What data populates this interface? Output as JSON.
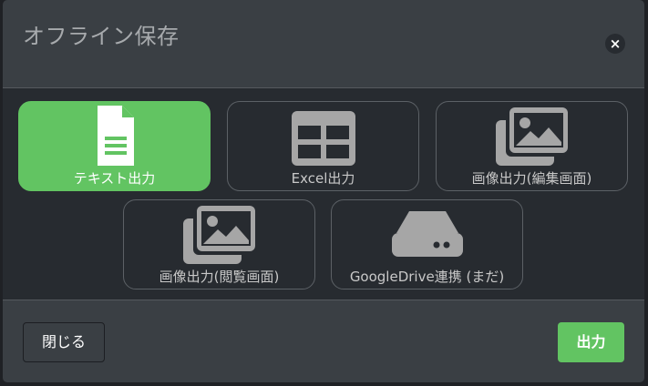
{
  "dialog": {
    "title": "オフライン保存",
    "close_symbol": "×"
  },
  "options": [
    {
      "label": "テキスト出力",
      "icon": "file-text-icon",
      "selected": true
    },
    {
      "label": "Excel出力",
      "icon": "table-icon",
      "selected": false
    },
    {
      "label": "画像出力(編集画面)",
      "icon": "images-icon",
      "selected": false
    },
    {
      "label": "画像出力(閲覧画面)",
      "icon": "images-icon",
      "selected": false
    },
    {
      "label": "GoogleDrive連携 (まだ)",
      "icon": "hard-drive-icon",
      "selected": false
    }
  ],
  "footer": {
    "close_label": "閉じる",
    "output_label": "出力"
  },
  "colors": {
    "accent": "#62c462",
    "dialog_bg": "#3a3f44",
    "body_bg": "#272b30",
    "icon_gray": "#a6a6a6"
  }
}
